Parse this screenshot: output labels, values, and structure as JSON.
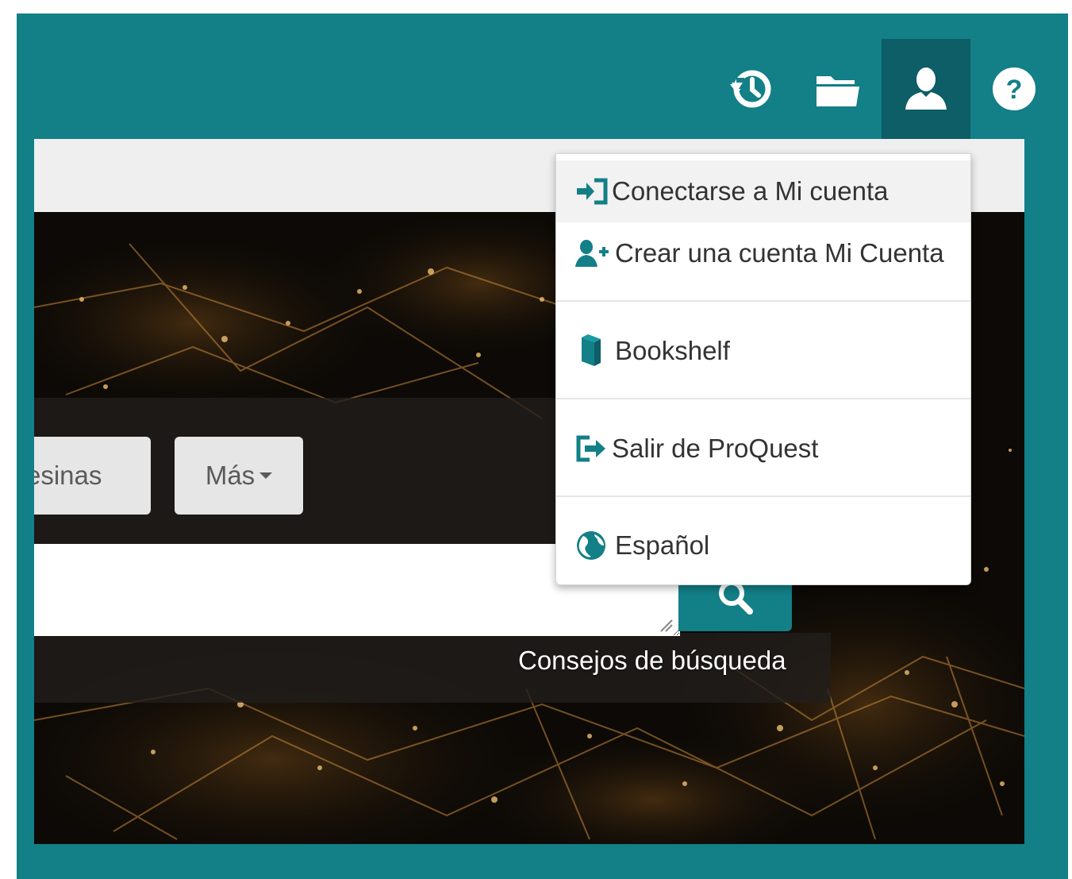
{
  "colors": {
    "brand_teal": "#137f87",
    "active_teal": "#0d5e66",
    "menu_text": "#333333",
    "menu_icon": "#137f87"
  },
  "topbar": {
    "icons": [
      "history-icon",
      "folder-icon",
      "user-icon",
      "help-icon"
    ],
    "active": "user-icon"
  },
  "search": {
    "tabs": [
      {
        "label": "esinas"
      },
      {
        "label": "Más"
      }
    ],
    "input_value": "",
    "tips_link": "Consejos de búsqueda"
  },
  "user_menu": {
    "items": [
      {
        "label": "Conectarse a Mi cuenta",
        "icon": "sign-in-icon"
      },
      {
        "label": "Crear una cuenta Mi Cuenta",
        "icon": "user-plus-icon"
      },
      {
        "label": "Bookshelf",
        "icon": "book-icon"
      },
      {
        "label": "Salir de ProQuest",
        "icon": "sign-out-icon"
      },
      {
        "label": "Español",
        "icon": "globe-icon"
      }
    ]
  }
}
